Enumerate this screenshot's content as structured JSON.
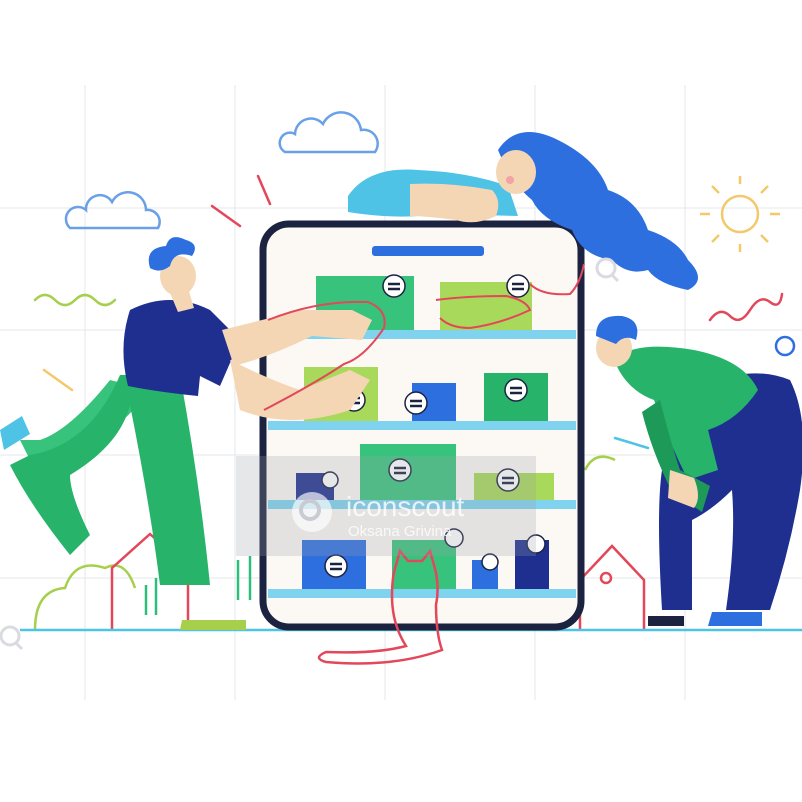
{
  "watermark": {
    "brand": "iconscout",
    "author": "Oksana Grivina"
  },
  "colors": {
    "green": "#27b46a",
    "dark_green": "#1e9a58",
    "light_green": "#8fd14f",
    "blue": "#2e6fe0",
    "navy": "#1f2f8f",
    "cyan": "#4ec3e6",
    "skin": "#f5d6b4",
    "red_line": "#e2475a",
    "outline": "#1c2340",
    "grid": "#e5e7eb"
  },
  "icons": [
    "cloud-icon",
    "sun-icon",
    "house-icon",
    "cat-icon",
    "search-icon"
  ]
}
